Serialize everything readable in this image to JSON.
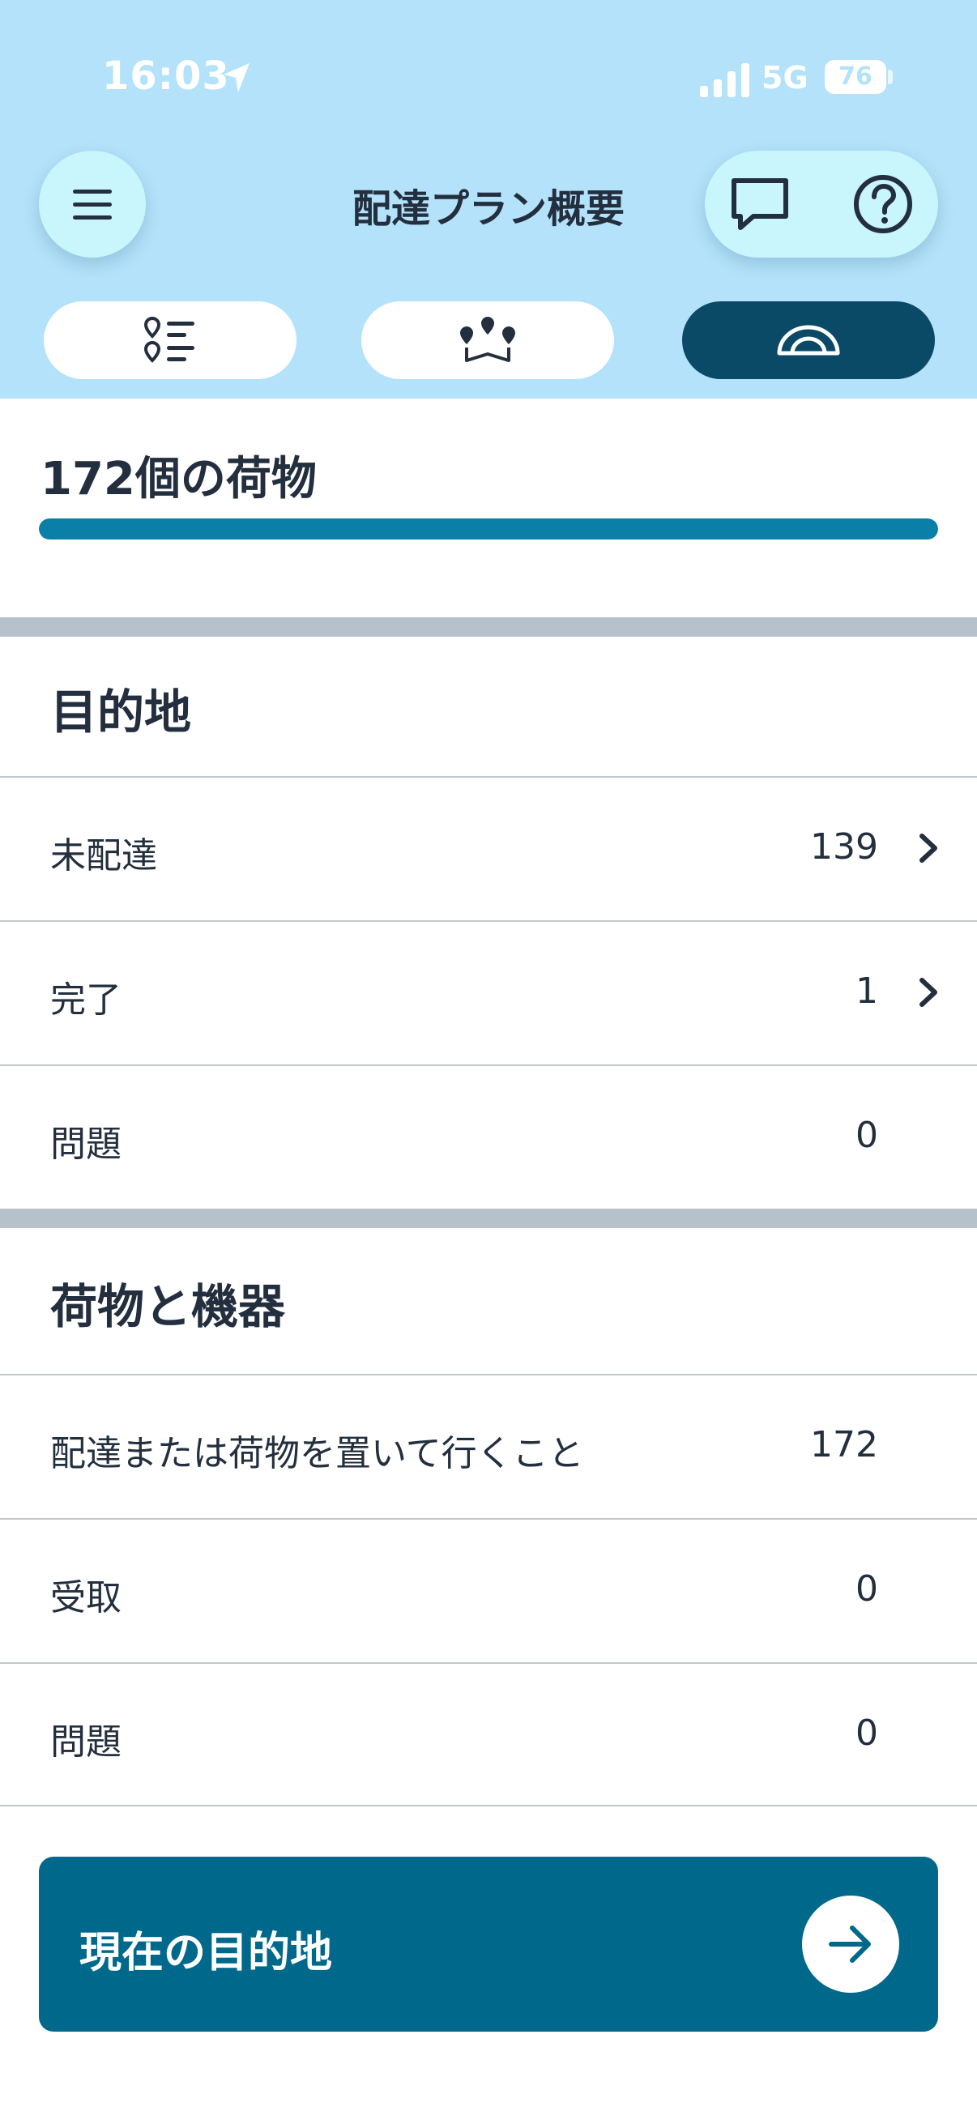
{
  "status_bar": {
    "time": "16:03",
    "network": "5G",
    "battery": "76"
  },
  "header": {
    "title": "配達プラン概要",
    "icons": {
      "menu": "hamburger-menu-icon",
      "chat": "chat-bubble-icon",
      "help": "question-mark-icon"
    }
  },
  "tabs": [
    {
      "icon": "list-pins-icon",
      "active": false
    },
    {
      "icon": "route-map-icon",
      "active": false
    },
    {
      "icon": "gauge-icon",
      "active": true
    }
  ],
  "packages": {
    "title": "172個の荷物",
    "progress_fraction": 1.0
  },
  "destinations": {
    "heading": "目的地",
    "rows": [
      {
        "label": "未配達",
        "value": "139",
        "has_chevron": true
      },
      {
        "label": "完了",
        "value": "1",
        "has_chevron": true
      },
      {
        "label": "問題",
        "value": "0",
        "has_chevron": false
      }
    ]
  },
  "packages_equipment": {
    "heading": "荷物と機器",
    "rows": [
      {
        "label": "配達または荷物を置いて行くこと",
        "value": "172"
      },
      {
        "label": "受取",
        "value": "0"
      },
      {
        "label": "問題",
        "value": "0"
      }
    ]
  },
  "cta": {
    "label": "現在の目的地",
    "icon": "arrow-right-icon"
  },
  "colors": {
    "header_bg": "#b3e2fa",
    "pill_bg": "#c9f5fc",
    "active_tab": "#0a4a66",
    "progress": "#0a7fa8",
    "cta_bg": "#00688b",
    "text": "#232f3e"
  }
}
